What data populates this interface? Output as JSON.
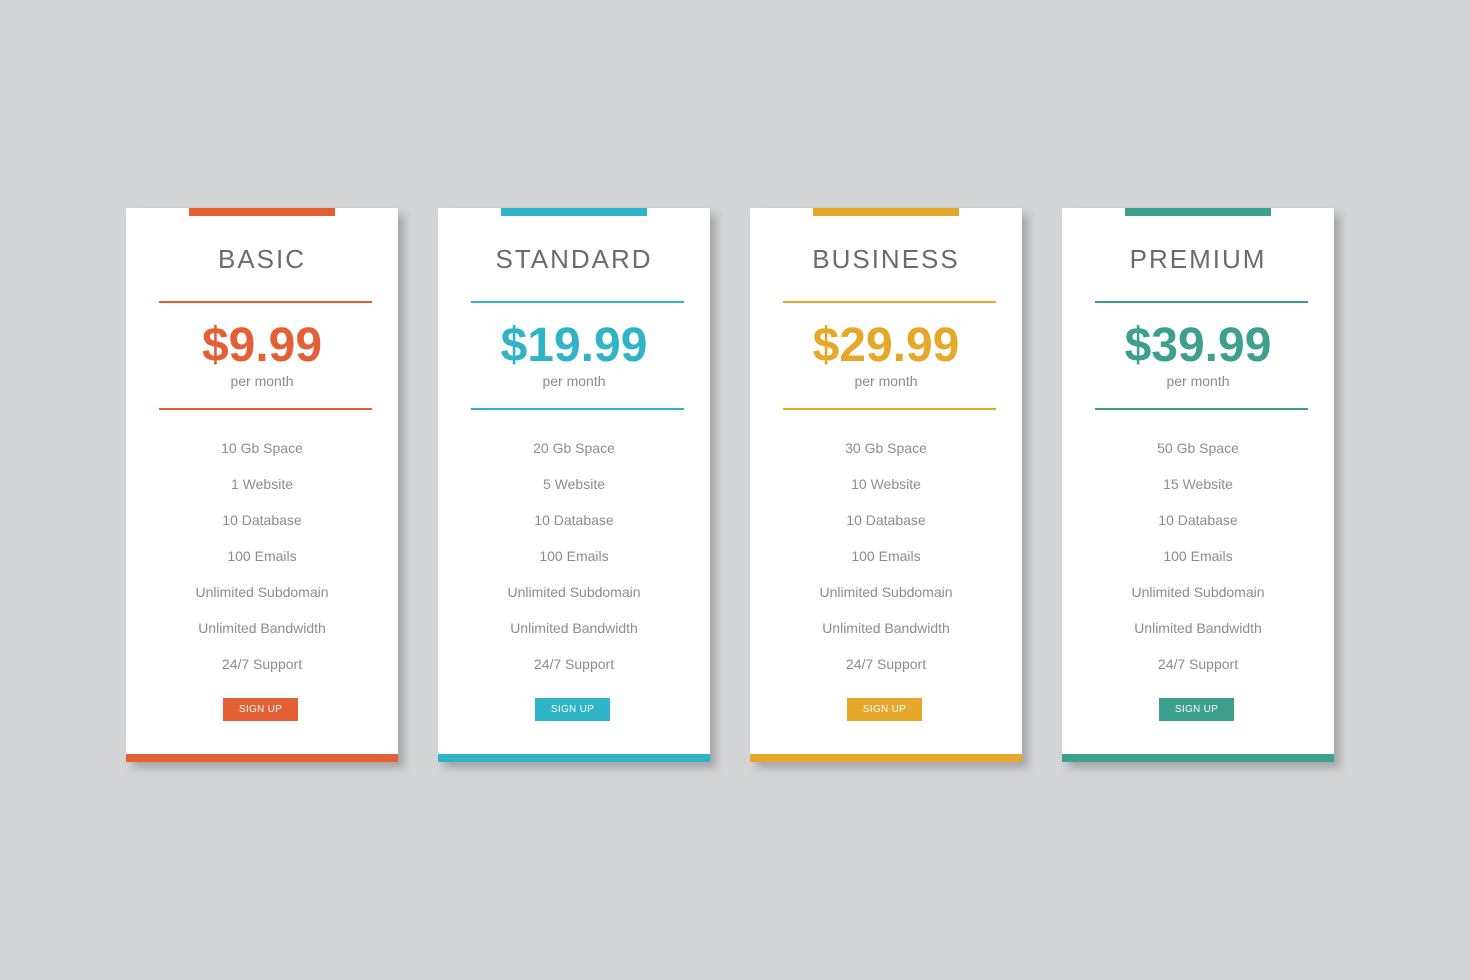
{
  "plans": [
    {
      "name": "BASIC",
      "price": "$9.99",
      "period": "per month",
      "color": "#e45f33",
      "features": [
        "10 Gb Space",
        "1 Website",
        "10 Database",
        "100 Emails",
        "Unlimited Subdomain",
        "Unlimited Bandwidth",
        "24/7 Support"
      ],
      "cta": "SIGN UP"
    },
    {
      "name": "STANDARD",
      "price": "$19.99",
      "period": "per month",
      "color": "#2fb3c6",
      "features": [
        "20 Gb Space",
        "5 Website",
        "10 Database",
        "100 Emails",
        "Unlimited Subdomain",
        "Unlimited Bandwidth",
        "24/7 Support"
      ],
      "cta": "SIGN UP"
    },
    {
      "name": "BUSINESS",
      "price": "$29.99",
      "period": "per month",
      "color": "#e5a82b",
      "features": [
        "30 Gb Space",
        "10 Website",
        "10 Database",
        "100 Emails",
        "Unlimited Subdomain",
        "Unlimited Bandwidth",
        "24/7 Support"
      ],
      "cta": "SIGN UP"
    },
    {
      "name": "PREMIUM",
      "price": "$39.99",
      "period": "per month",
      "color": "#3d9f8e",
      "features": [
        "50 Gb Space",
        "15 Website",
        "10 Database",
        "100 Emails",
        "Unlimited Subdomain",
        "Unlimited Bandwidth",
        "24/7 Support"
      ],
      "cta": "SIGN UP"
    }
  ]
}
